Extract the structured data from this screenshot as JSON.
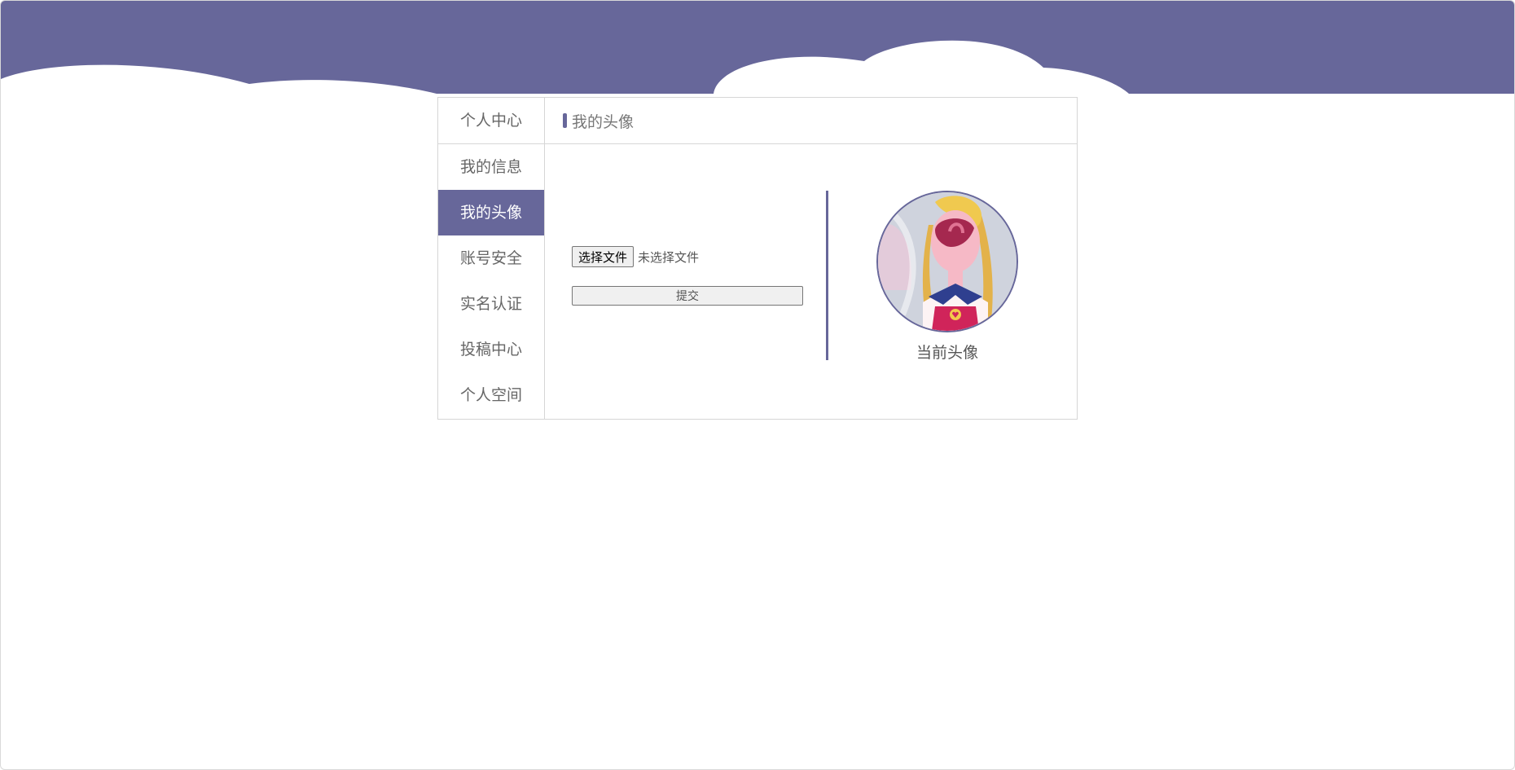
{
  "colors": {
    "accent": "#67679a",
    "border": "#d6d6d6",
    "text": "#666666"
  },
  "sidebar": {
    "heading": "个人中心",
    "items": [
      {
        "label": "我的信息",
        "active": false
      },
      {
        "label": "我的头像",
        "active": true
      },
      {
        "label": "账号安全",
        "active": false
      },
      {
        "label": "实名认证",
        "active": false
      },
      {
        "label": "投稿中心",
        "active": false
      },
      {
        "label": "个人空间",
        "active": false
      }
    ]
  },
  "main": {
    "title": "我的头像",
    "upload": {
      "choose_label": "选择文件",
      "no_file_text": "未选择文件",
      "submit_label": "提交"
    },
    "avatar": {
      "caption": "当前头像",
      "icon": "user-avatar-image"
    }
  }
}
